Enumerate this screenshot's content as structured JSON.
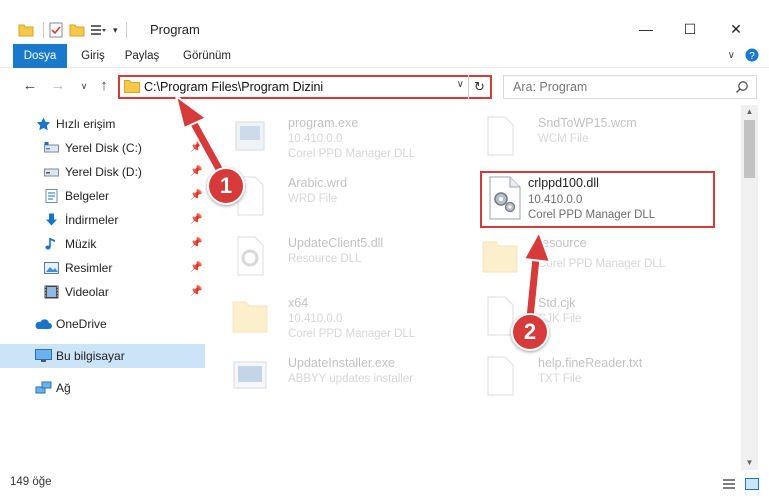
{
  "window": {
    "title": "Program",
    "controls": {
      "minimize": "—",
      "maximize": "☐",
      "close": "✕"
    }
  },
  "ribbon": {
    "tabs": [
      "Dosya",
      "Giriş",
      "Paylaş",
      "Görünüm"
    ]
  },
  "address_bar": {
    "path": "C:\\Program Files\\Program Dizini",
    "refresh_glyph": "↻",
    "dropdown_glyph": "∨"
  },
  "search": {
    "placeholder": "Ara: Program"
  },
  "navigation": {
    "quick_access": "Hızlı erişim",
    "items": [
      {
        "label": "Yerel Disk (C:)",
        "icon": "drive-icon",
        "pinned": true
      },
      {
        "label": "Yerel Disk (D:)",
        "icon": "drive-icon",
        "pinned": true
      },
      {
        "label": "Belgeler",
        "icon": "documents-icon",
        "pinned": true
      },
      {
        "label": "İndirmeler",
        "icon": "downloads-icon",
        "pinned": true
      },
      {
        "label": "Müzik",
        "icon": "music-icon",
        "pinned": true
      },
      {
        "label": "Resimler",
        "icon": "pictures-icon",
        "pinned": true
      },
      {
        "label": "Videolar",
        "icon": "videos-icon",
        "pinned": true
      }
    ],
    "onedrive": "OneDrive",
    "this_pc": "Bu bilgisayar",
    "network": "Ağ"
  },
  "files": [
    {
      "name": "program.exe",
      "line2": "10.410.0.0",
      "line3": "Corel PPD Manager DLL",
      "icon": "exe-icon"
    },
    {
      "name": "SndToWP15.wcm",
      "line2": "WCM File",
      "line3": "",
      "icon": "file-icon"
    },
    {
      "name": "Arabic.wrd",
      "line2": "WRD File",
      "line3": "",
      "icon": "file-icon"
    },
    {
      "name": "crlppd100.dll",
      "line2": "10.410.0.0",
      "line3": "Corel PPD Manager DLL",
      "icon": "dll-gear-icon"
    },
    {
      "name": "UpdateClient5.dll",
      "line2": "Resource DLL",
      "line3": "",
      "icon": "dll-icon"
    },
    {
      "name": "resource",
      "line2": "Corel PPD Manager DLL",
      "line3": "",
      "icon": "folder-icon"
    },
    {
      "name": "x64",
      "line2": "10.410.0.0",
      "line3": "Corel PPD Manager DLL",
      "icon": "folder-icon"
    },
    {
      "name": "Std.cjk",
      "line2": "CJK File",
      "line3": "",
      "icon": "file-icon"
    },
    {
      "name": "UpdateInstaller.exe",
      "line2": "ABBYY updates installer",
      "line3": "",
      "icon": "installer-icon"
    },
    {
      "name": "help.fineReader.txt",
      "line2": "TXT File",
      "line3": "",
      "icon": "file-icon"
    }
  ],
  "status": {
    "count": "149 öğe"
  },
  "annotations": {
    "step1": "1",
    "step2": "2",
    "color": "#d63a3a"
  },
  "colors": {
    "accent": "#1979ca",
    "highlight": "#d63a3a",
    "selected": "#cce4f7"
  }
}
